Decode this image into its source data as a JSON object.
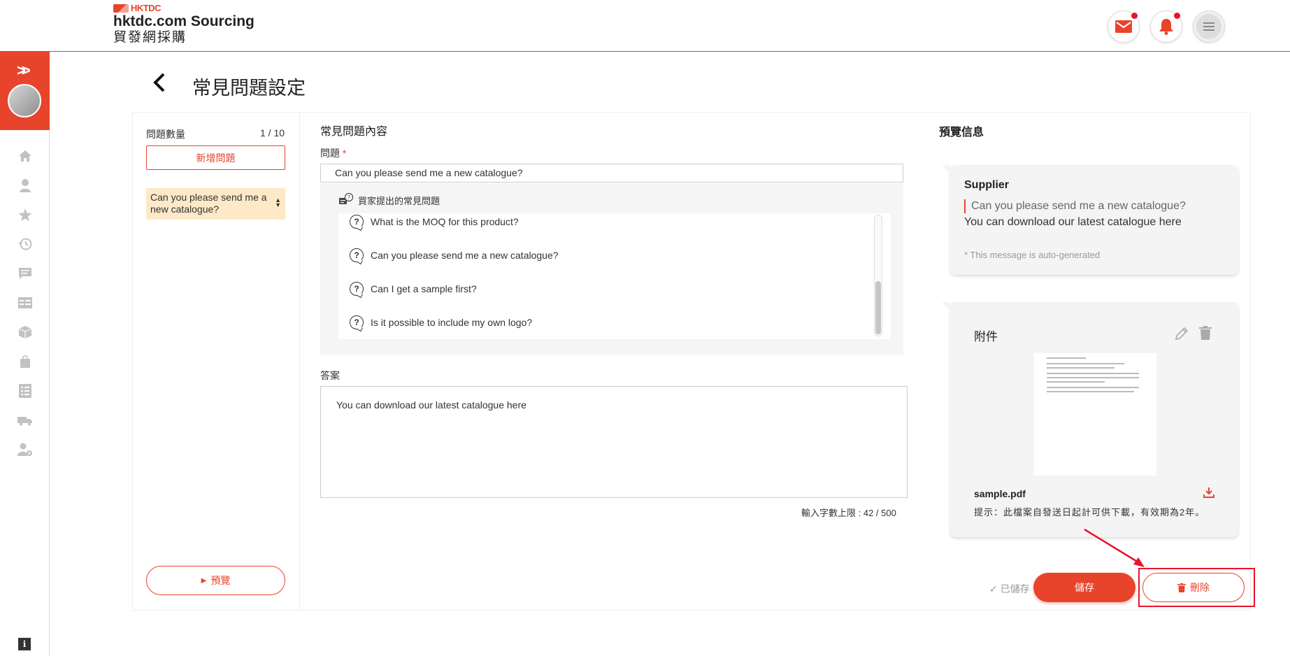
{
  "header": {
    "brand_small": "HKTDC",
    "brand_en": "hktdc.com Sourcing",
    "brand_zh": "貿發網採購"
  },
  "page": {
    "title": "常見問題設定"
  },
  "left": {
    "count_label": "問題數量",
    "count_value": "1 / 10",
    "add_button": "新增問題",
    "questions": [
      "Can you please send me a new catalogue?"
    ],
    "preview_button": "預覽"
  },
  "middle": {
    "section_title": "常見問題內容",
    "question_label": "問題",
    "question_required": "*",
    "question_value": "Can you please send me a new catalogue?",
    "dropdown_title": "買家提出的常見問題",
    "dropdown_options": [
      "What is the MOQ for this product?",
      "Can you please send me a new catalogue?",
      "Can I get a sample first?",
      "Is it possible to include my own logo?"
    ],
    "answer_label": "答案",
    "answer_value": "You can download our latest catalogue here",
    "char_limit": "輸入字數上限 : 42 / 500"
  },
  "right": {
    "section_title": "預覽信息",
    "supplier_name": "Supplier",
    "preview_question": "Can you please send me a new catalogue?",
    "preview_answer": "You can download our latest catalogue here",
    "auto_note": "* This message is auto-generated",
    "attachment_title": "附件",
    "file_name": "sample.pdf",
    "file_hint": "提示：此檔案自發送日起計可供下載，有效期為2年。",
    "saved_status": "✓ 已儲存",
    "save_button": "儲存",
    "delete_button": "刪除"
  },
  "colors": {
    "accent": "#e8442b",
    "highlight": "#fde9c8"
  },
  "icons": [
    "mail-icon",
    "bell-icon",
    "menu-icon",
    "home-icon",
    "user-icon",
    "star-icon",
    "history-icon",
    "chat-icon",
    "list-icon",
    "box-icon",
    "bag-icon",
    "checklist-icon",
    "truck-icon",
    "user-settings-icon",
    "info-icon"
  ]
}
